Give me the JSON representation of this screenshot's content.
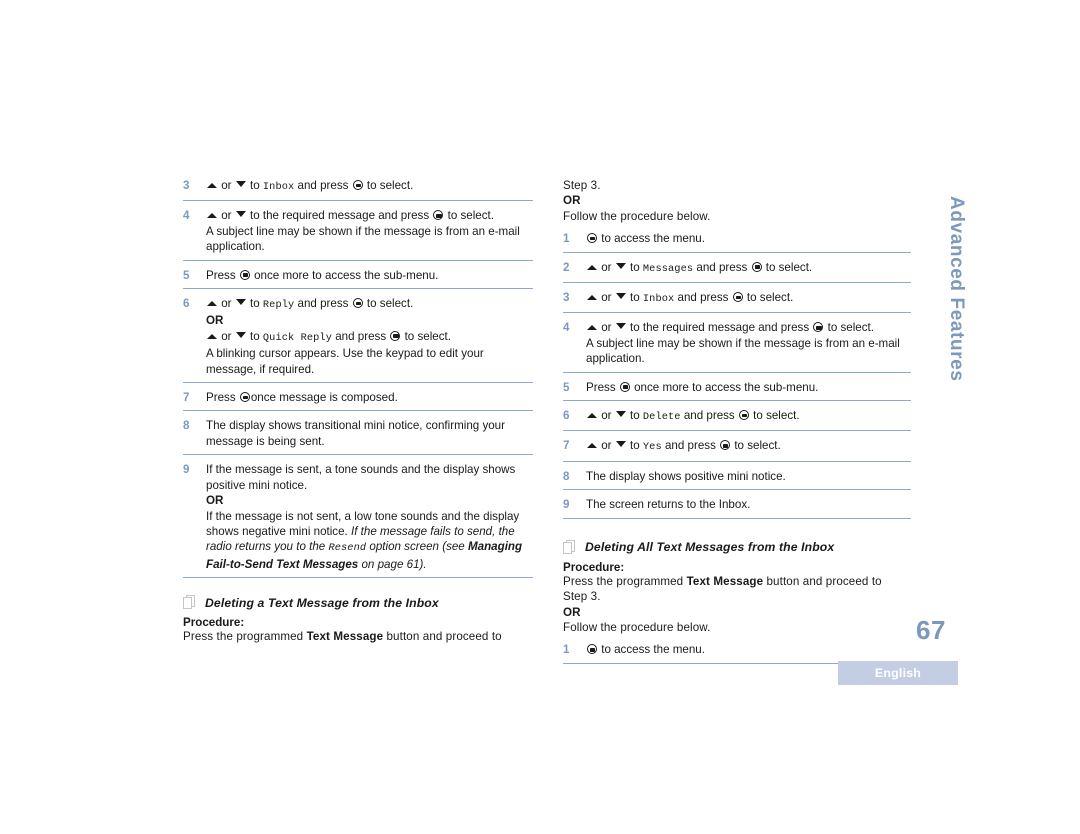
{
  "page": {
    "number": "67",
    "side_tab_label": "Advanced Features",
    "language_badge": "English"
  },
  "icons": {
    "nav_up": "triangle-up-icon",
    "nav_down": "triangle-down-icon",
    "menu_button": "menu-select-button-icon",
    "section_marker": "pages-icon"
  },
  "left_column": {
    "steps": [
      {
        "number": "3",
        "lines": [
          {
            "segments": [
              {
                "type": "icon",
                "value": "nav-up"
              },
              {
                "type": "text",
                "value": " or "
              },
              {
                "type": "icon",
                "value": "nav-down"
              },
              {
                "type": "text",
                "value": " to "
              },
              {
                "type": "mono",
                "value": "Inbox"
              },
              {
                "type": "text",
                "value": " and press "
              },
              {
                "type": "icon",
                "value": "menu-btn"
              },
              {
                "type": "text",
                "value": " to select."
              }
            ]
          }
        ]
      },
      {
        "number": "4",
        "lines": [
          {
            "segments": [
              {
                "type": "icon",
                "value": "nav-up"
              },
              {
                "type": "text",
                "value": " or "
              },
              {
                "type": "icon",
                "value": "nav-down"
              },
              {
                "type": "text",
                "value": " to the required message and press "
              },
              {
                "type": "icon",
                "value": "menu-btn"
              },
              {
                "type": "text",
                "value": " to select."
              }
            ]
          },
          {
            "segments": [
              {
                "type": "text",
                "value": "A subject line may be shown if the message is from an e-mail application."
              }
            ]
          }
        ]
      },
      {
        "number": "5",
        "lines": [
          {
            "segments": [
              {
                "type": "text",
                "value": "Press "
              },
              {
                "type": "icon",
                "value": "menu-btn"
              },
              {
                "type": "text",
                "value": " once more to access the sub-menu."
              }
            ]
          }
        ]
      },
      {
        "number": "6",
        "lines": [
          {
            "segments": [
              {
                "type": "icon",
                "value": "nav-up"
              },
              {
                "type": "text",
                "value": " or "
              },
              {
                "type": "icon",
                "value": "nav-down"
              },
              {
                "type": "text",
                "value": " to "
              },
              {
                "type": "mono",
                "value": "Reply"
              },
              {
                "type": "text",
                "value": " and press "
              },
              {
                "type": "icon",
                "value": "menu-btn"
              },
              {
                "type": "text",
                "value": " to select."
              }
            ]
          },
          {
            "segments": [
              {
                "type": "bold",
                "value": "OR"
              }
            ]
          },
          {
            "segments": [
              {
                "type": "icon",
                "value": "nav-up"
              },
              {
                "type": "text",
                "value": " or "
              },
              {
                "type": "icon",
                "value": "nav-down"
              },
              {
                "type": "text",
                "value": " to "
              },
              {
                "type": "mono",
                "value": "Quick Reply"
              },
              {
                "type": "text",
                "value": " and press "
              },
              {
                "type": "icon",
                "value": "menu-btn"
              },
              {
                "type": "text",
                "value": " to select."
              }
            ]
          },
          {
            "segments": [
              {
                "type": "text",
                "value": "A blinking cursor appears. Use the keypad to edit your message, if required."
              }
            ]
          }
        ]
      },
      {
        "number": "7",
        "lines": [
          {
            "segments": [
              {
                "type": "text",
                "value": "Press "
              },
              {
                "type": "icon",
                "value": "menu-btn"
              },
              {
                "type": "text",
                "value": "once message is composed."
              }
            ]
          }
        ]
      },
      {
        "number": "8",
        "lines": [
          {
            "segments": [
              {
                "type": "text",
                "value": "The display shows transitional mini notice, confirming your message is being sent."
              }
            ]
          }
        ]
      },
      {
        "number": "9",
        "lines": [
          {
            "segments": [
              {
                "type": "text",
                "value": "If the message is sent, a tone sounds and the display shows positive mini notice."
              }
            ]
          },
          {
            "segments": [
              {
                "type": "bold",
                "value": "OR"
              }
            ]
          },
          {
            "segments": [
              {
                "type": "text",
                "value": "If the message is not sent, a low tone sounds and the display shows negative mini notice. "
              },
              {
                "type": "italic",
                "value": "If the message fails to send, the radio returns you to the "
              },
              {
                "type": "mono-italic",
                "value": "Resend"
              },
              {
                "type": "italic",
                "value": " option screen (see "
              },
              {
                "type": "bold-italic",
                "value": "Managing Fail-to-Send Text Messages"
              },
              {
                "type": "italic",
                "value": " on page 61)."
              }
            ]
          }
        ]
      }
    ],
    "section": {
      "title": "Deleting a Text Message from the Inbox",
      "procedure_label": "Procedure:",
      "intro_lines": [
        {
          "segments": [
            {
              "type": "text",
              "value": "Press the programmed "
            },
            {
              "type": "bold",
              "value": "Text Message"
            },
            {
              "type": "text",
              "value": " button and proceed to"
            }
          ]
        }
      ]
    }
  },
  "right_column": {
    "lead_lines": [
      {
        "segments": [
          {
            "type": "text",
            "value": "Step 3."
          }
        ]
      },
      {
        "segments": [
          {
            "type": "bold",
            "value": "OR"
          }
        ]
      },
      {
        "segments": [
          {
            "type": "text",
            "value": "Follow the procedure below."
          }
        ]
      }
    ],
    "steps": [
      {
        "number": "1",
        "lines": [
          {
            "segments": [
              {
                "type": "icon",
                "value": "menu-btn"
              },
              {
                "type": "text",
                "value": " to access the menu."
              }
            ]
          }
        ]
      },
      {
        "number": "2",
        "lines": [
          {
            "segments": [
              {
                "type": "icon",
                "value": "nav-up"
              },
              {
                "type": "text",
                "value": " or "
              },
              {
                "type": "icon",
                "value": "nav-down"
              },
              {
                "type": "text",
                "value": " to "
              },
              {
                "type": "mono",
                "value": "Messages"
              },
              {
                "type": "text",
                "value": " and press "
              },
              {
                "type": "icon",
                "value": "menu-btn"
              },
              {
                "type": "text",
                "value": " to select."
              }
            ]
          }
        ]
      },
      {
        "number": "3",
        "lines": [
          {
            "segments": [
              {
                "type": "icon",
                "value": "nav-up"
              },
              {
                "type": "text",
                "value": " or "
              },
              {
                "type": "icon",
                "value": "nav-down"
              },
              {
                "type": "text",
                "value": " to "
              },
              {
                "type": "mono",
                "value": "Inbox"
              },
              {
                "type": "text",
                "value": " and press "
              },
              {
                "type": "icon",
                "value": "menu-btn"
              },
              {
                "type": "text",
                "value": " to select."
              }
            ]
          }
        ]
      },
      {
        "number": "4",
        "lines": [
          {
            "segments": [
              {
                "type": "icon",
                "value": "nav-up"
              },
              {
                "type": "text",
                "value": " or "
              },
              {
                "type": "icon",
                "value": "nav-down"
              },
              {
                "type": "text",
                "value": " to the required message and press "
              },
              {
                "type": "icon",
                "value": "menu-btn"
              },
              {
                "type": "text",
                "value": " to select."
              }
            ]
          },
          {
            "segments": [
              {
                "type": "text",
                "value": "A subject line may be shown if the message is from an e-mail application."
              }
            ]
          }
        ]
      },
      {
        "number": "5",
        "lines": [
          {
            "segments": [
              {
                "type": "text",
                "value": "Press "
              },
              {
                "type": "icon",
                "value": "menu-btn"
              },
              {
                "type": "text",
                "value": " once more to access the sub-menu."
              }
            ]
          }
        ]
      },
      {
        "number": "6",
        "lines": [
          {
            "segments": [
              {
                "type": "icon",
                "value": "nav-up"
              },
              {
                "type": "text",
                "value": " or "
              },
              {
                "type": "icon",
                "value": "nav-down"
              },
              {
                "type": "text",
                "value": " to "
              },
              {
                "type": "mono",
                "value": "Delete"
              },
              {
                "type": "text",
                "value": " and press "
              },
              {
                "type": "icon",
                "value": "menu-btn"
              },
              {
                "type": "text",
                "value": " to select."
              }
            ]
          }
        ]
      },
      {
        "number": "7",
        "lines": [
          {
            "segments": [
              {
                "type": "icon",
                "value": "nav-up"
              },
              {
                "type": "text",
                "value": " or "
              },
              {
                "type": "icon",
                "value": "nav-down"
              },
              {
                "type": "text",
                "value": " to "
              },
              {
                "type": "mono",
                "value": "Yes"
              },
              {
                "type": "text",
                "value": " and press "
              },
              {
                "type": "icon",
                "value": "menu-btn"
              },
              {
                "type": "text",
                "value": " to select."
              }
            ]
          }
        ]
      },
      {
        "number": "8",
        "lines": [
          {
            "segments": [
              {
                "type": "text",
                "value": "The display shows positive mini notice."
              }
            ]
          }
        ]
      },
      {
        "number": "9",
        "lines": [
          {
            "segments": [
              {
                "type": "text",
                "value": "The screen returns to the Inbox."
              }
            ]
          }
        ]
      }
    ],
    "section": {
      "title": "Deleting All Text Messages from the Inbox",
      "procedure_label": "Procedure:",
      "intro_lines": [
        {
          "segments": [
            {
              "type": "text",
              "value": "Press the programmed "
            },
            {
              "type": "bold",
              "value": "Text Message"
            },
            {
              "type": "text",
              "value": " button and proceed to"
            }
          ]
        },
        {
          "segments": [
            {
              "type": "text",
              "value": "Step 3."
            }
          ]
        },
        {
          "segments": [
            {
              "type": "bold",
              "value": "OR"
            }
          ]
        },
        {
          "segments": [
            {
              "type": "text",
              "value": "Follow the procedure below."
            }
          ]
        }
      ]
    },
    "trailing_steps": [
      {
        "number": "1",
        "lines": [
          {
            "segments": [
              {
                "type": "icon",
                "value": "menu-btn"
              },
              {
                "type": "text",
                "value": " to access the menu."
              }
            ]
          }
        ]
      }
    ]
  },
  "colors": {
    "accent_blue": "#7c99bd",
    "rule_blue": "#8fa9c9",
    "badge_bg": "#c3cee2",
    "badge_text": "#ffffff",
    "body_text": "#1a1a1a"
  }
}
